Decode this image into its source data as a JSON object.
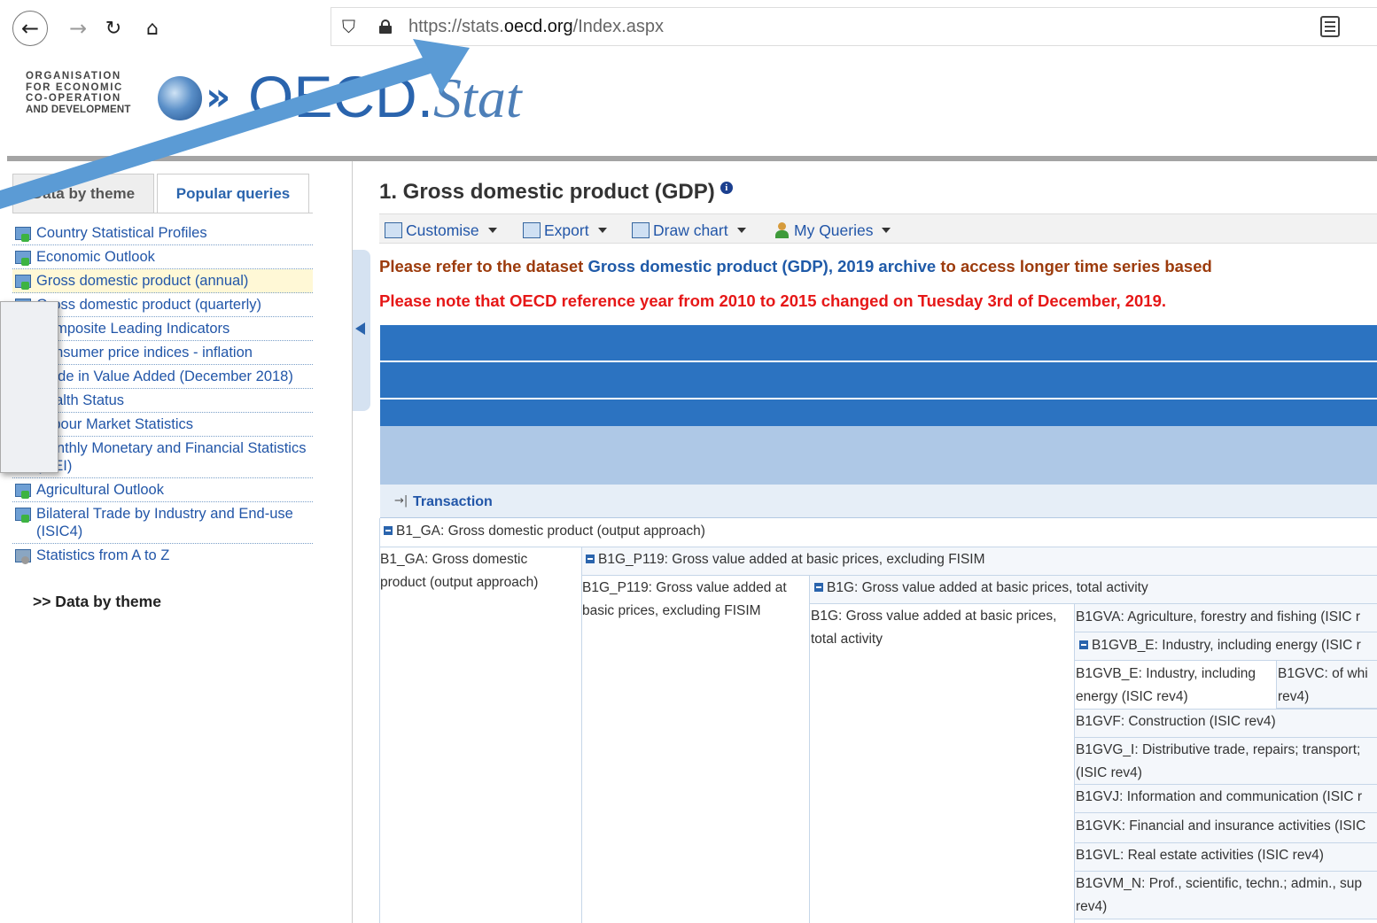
{
  "browser": {
    "url_prefix": "https://stats.",
    "url_domain": "oecd.org",
    "url_path": "/Index.aspx"
  },
  "logo": {
    "org_lines": [
      "ORGANISATION",
      "FOR ECONOMIC",
      "CO-OPERATION",
      "AND DEVELOPMENT"
    ],
    "brand_main": "OECD",
    "brand_dot": ".",
    "brand_stat": "Stat"
  },
  "tabs": {
    "data_by_theme": "Data by theme",
    "popular_queries": "Popular queries"
  },
  "popular_queries": [
    "Country Statistical Profiles",
    "Economic Outlook",
    "Gross domestic product (annual)",
    "Gross domestic product (quarterly)",
    "Composite Leading Indicators",
    "Consumer price indices - inflation",
    "Trade in Value Added (December 2018)",
    "Health Status",
    "Labour Market Statistics",
    "Monthly Monetary and Financial Statistics (MEI)",
    "Agricultural Outlook",
    "Bilateral Trade by Industry and End-use (ISIC4)",
    "Statistics from A to Z"
  ],
  "data_by_theme_link": ">> Data by theme",
  "main": {
    "title": "1. Gross domestic product (GDP)",
    "toolbar": {
      "customise": "Customise",
      "export": "Export",
      "draw_chart": "Draw chart",
      "my_queries": "My Queries"
    },
    "note1_prefix": "Please refer to the dataset",
    "note1_link": "Gross domestic product (GDP), 2019 archive",
    "note1_suffix": "to access longer time series based",
    "note2": "Please note that OECD reference year from 2010 to 2015 changed on Tuesday 3rd of December, 2019.",
    "transaction_label": "Transaction"
  },
  "table": {
    "r_b1ga_header": "B1_GA: Gross domestic product (output approach)",
    "b1ga_cell_l1": "B1_GA: Gross domestic",
    "b1ga_cell_l2": "product (output approach)",
    "r_b1gp_header": "B1G_P119: Gross value added at basic prices, excluding FISIM",
    "b1gp_cell_l1": "B1G_P119: Gross value added at",
    "b1gp_cell_l2": "basic prices, excluding FISIM",
    "r_b1g_header": "B1G: Gross value added at basic prices, total activity",
    "b1g_cell_l1": "B1G: Gross value added at basic prices,",
    "b1g_cell_l2": "total activity",
    "b1gva": "B1GVA: Agriculture, forestry and fishing (ISIC r",
    "b1gvbe_header": "B1GVB_E: Industry, including energy (ISIC r",
    "b1gvbe_cell_l1": "B1GVB_E: Industry, including",
    "b1gvbe_cell_l2": "energy (ISIC rev4)",
    "b1gvc_l1": "B1GVC: of whi",
    "b1gvc_l2": "rev4)",
    "b1gvf": "B1GVF: Construction (ISIC rev4)",
    "b1gvgi_l1": "B1GVG_I: Distributive trade, repairs; transport;",
    "b1gvgi_l2": "(ISIC rev4)",
    "b1gvj": "B1GVJ: Information and communication (ISIC r",
    "b1gvk": "B1GVK: Financial and insurance activities (ISIC",
    "b1gvl": "B1GVL: Real estate activities (ISIC rev4)",
    "b1gvmn_l1": "B1GVM_N: Prof., scientific, techn.; admin., sup",
    "b1gvmn_l2": "rev4)"
  },
  "colors": {
    "accent_blue": "#2a64ad",
    "header_band": "#2c73c1",
    "annotation_arrow": "#5b9bd5",
    "note_red": "#e61717"
  }
}
